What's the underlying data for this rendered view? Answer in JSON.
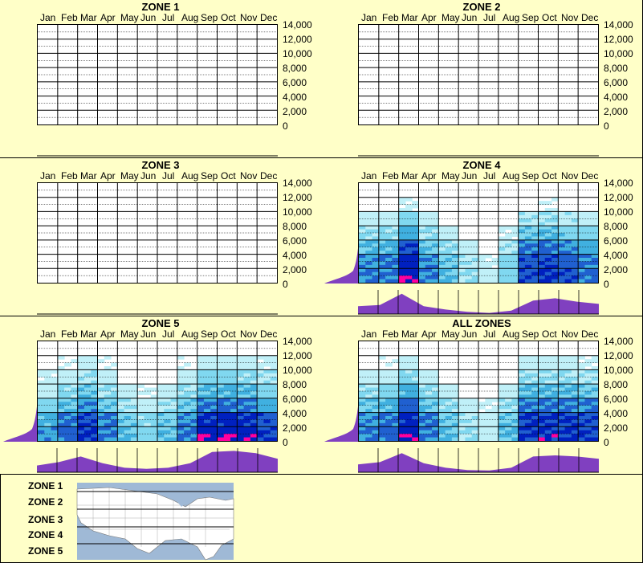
{
  "months": [
    "Jan",
    "Feb",
    "Mar",
    "Apr",
    "May",
    "Jun",
    "Jul",
    "Aug",
    "Sep",
    "Oct",
    "Nov",
    "Dec"
  ],
  "yticks": [
    "14,000",
    "12,000",
    "10,000",
    "8,000",
    "6,000",
    "4,000",
    "2,000",
    "0"
  ],
  "panels": [
    {
      "title": "ZONE 1",
      "has_data": false
    },
    {
      "title": "ZONE 2",
      "has_data": false
    },
    {
      "title": "ZONE 3",
      "has_data": false
    },
    {
      "title": "ZONE 4",
      "has_data": true
    },
    {
      "title": "ZONE 5",
      "has_data": true
    },
    {
      "title": "ALL ZONES",
      "has_data": true
    }
  ],
  "legend": {
    "labels": [
      "ZONE 1",
      "ZONE 2",
      "ZONE 3",
      "ZONE 4",
      "ZONE 5"
    ]
  },
  "colors": {
    "background": "#ffffc8",
    "distribution": "#8040c0",
    "heat_low": "#c0f0f8",
    "heat_mid": "#40b0e0",
    "heat_high": "#0020c0",
    "heat_peak": "#ff00a0"
  },
  "chart_data": [
    {
      "type": "heatmap",
      "title": "ZONE 1",
      "ylim": [
        0,
        14000
      ],
      "categories": [
        "Jan",
        "Feb",
        "Mar",
        "Apr",
        "May",
        "Jun",
        "Jul",
        "Aug",
        "Sep",
        "Oct",
        "Nov",
        "Dec"
      ],
      "values": []
    },
    {
      "type": "heatmap",
      "title": "ZONE 2",
      "ylim": [
        0,
        14000
      ],
      "categories": [
        "Jan",
        "Feb",
        "Mar",
        "Apr",
        "May",
        "Jun",
        "Jul",
        "Aug",
        "Sep",
        "Oct",
        "Nov",
        "Dec"
      ],
      "values": []
    },
    {
      "type": "heatmap",
      "title": "ZONE 3",
      "ylim": [
        0,
        14000
      ],
      "categories": [
        "Jan",
        "Feb",
        "Mar",
        "Apr",
        "May",
        "Jun",
        "Jul",
        "Aug",
        "Sep",
        "Oct",
        "Nov",
        "Dec"
      ],
      "values": []
    },
    {
      "type": "heatmap",
      "title": "ZONE 4",
      "ylim": [
        0,
        14000
      ],
      "categories": [
        "Jan",
        "Feb",
        "Mar",
        "Apr",
        "May",
        "Jun",
        "Jul",
        "Aug",
        "Sep",
        "Oct",
        "Nov",
        "Dec"
      ],
      "month_profile": [
        0.35,
        0.4,
        0.9,
        0.35,
        0.2,
        0.1,
        0.05,
        0.15,
        0.6,
        0.7,
        0.55,
        0.45
      ],
      "elev_profile": [
        1.0,
        0.9,
        0.6,
        0.3,
        0.15,
        0.05,
        0.02
      ]
    },
    {
      "type": "heatmap",
      "title": "ZONE 5",
      "ylim": [
        0,
        14000
      ],
      "categories": [
        "Jan",
        "Feb",
        "Mar",
        "Apr",
        "May",
        "Jun",
        "Jul",
        "Aug",
        "Sep",
        "Oct",
        "Nov",
        "Dec"
      ],
      "month_profile": [
        0.3,
        0.45,
        0.7,
        0.4,
        0.2,
        0.15,
        0.2,
        0.4,
        0.9,
        0.95,
        0.85,
        0.6
      ],
      "elev_profile": [
        1.0,
        0.85,
        0.45,
        0.25,
        0.15,
        0.08,
        0.03
      ]
    },
    {
      "type": "heatmap",
      "title": "ALL ZONES",
      "ylim": [
        0,
        14000
      ],
      "categories": [
        "Jan",
        "Feb",
        "Mar",
        "Apr",
        "May",
        "Jun",
        "Jul",
        "Aug",
        "Sep",
        "Oct",
        "Nov",
        "Dec"
      ],
      "month_profile": [
        0.35,
        0.45,
        0.85,
        0.4,
        0.2,
        0.1,
        0.08,
        0.2,
        0.7,
        0.75,
        0.7,
        0.6
      ],
      "elev_profile": [
        1.0,
        0.9,
        0.55,
        0.3,
        0.15,
        0.07,
        0.03
      ]
    }
  ]
}
